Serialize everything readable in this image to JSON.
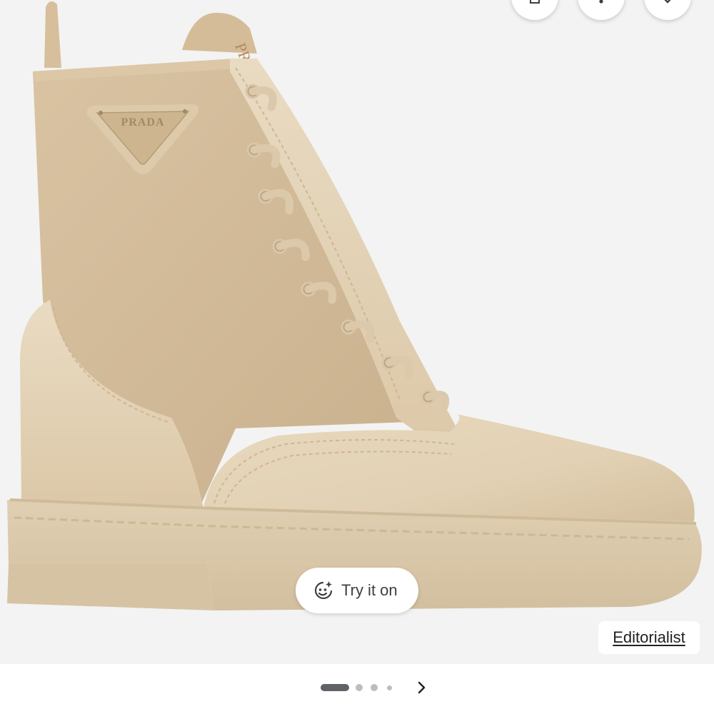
{
  "viewer": {
    "image_alt": "Beige leather and nylon combat boot with triangle logo plaque",
    "logo_plaque_text": "PRADA",
    "heel_tab_text": "PR"
  },
  "top_actions": {
    "icons": [
      "bookmark-icon",
      "more-vert-icon",
      "close-icon"
    ]
  },
  "try_on": {
    "label": "Try it on",
    "icon": "sparkle-face-icon"
  },
  "source": {
    "label": "Editorialist"
  },
  "pager": {
    "total": 4,
    "active_index": 0,
    "next_icon": "chevron-right-icon"
  },
  "colors": {
    "background": "#f3f3f3",
    "boot_nylon": "#cfb897",
    "boot_leather": "#e3d2b6",
    "sole": "#dccaae",
    "active_dot": "#5f6368",
    "inactive_dot": "#bdbdbd"
  }
}
